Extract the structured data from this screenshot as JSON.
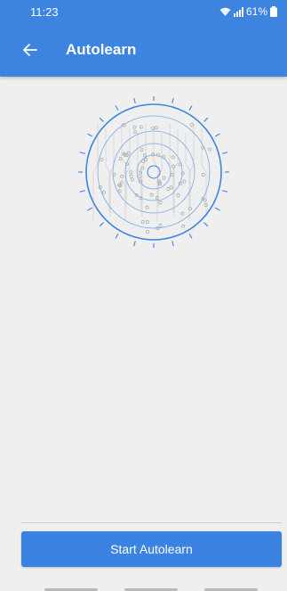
{
  "status": {
    "time": "11:23",
    "battery": "61%"
  },
  "appbar": {
    "title": "Autolearn"
  },
  "action": {
    "start_label": "Start Autolearn"
  },
  "colors": {
    "primary": "#3d84e0",
    "background": "#efefef"
  },
  "icons": {
    "back": "arrow-left-icon",
    "wifi": "wifi-icon",
    "signal": "signal-icon",
    "battery": "battery-icon"
  }
}
